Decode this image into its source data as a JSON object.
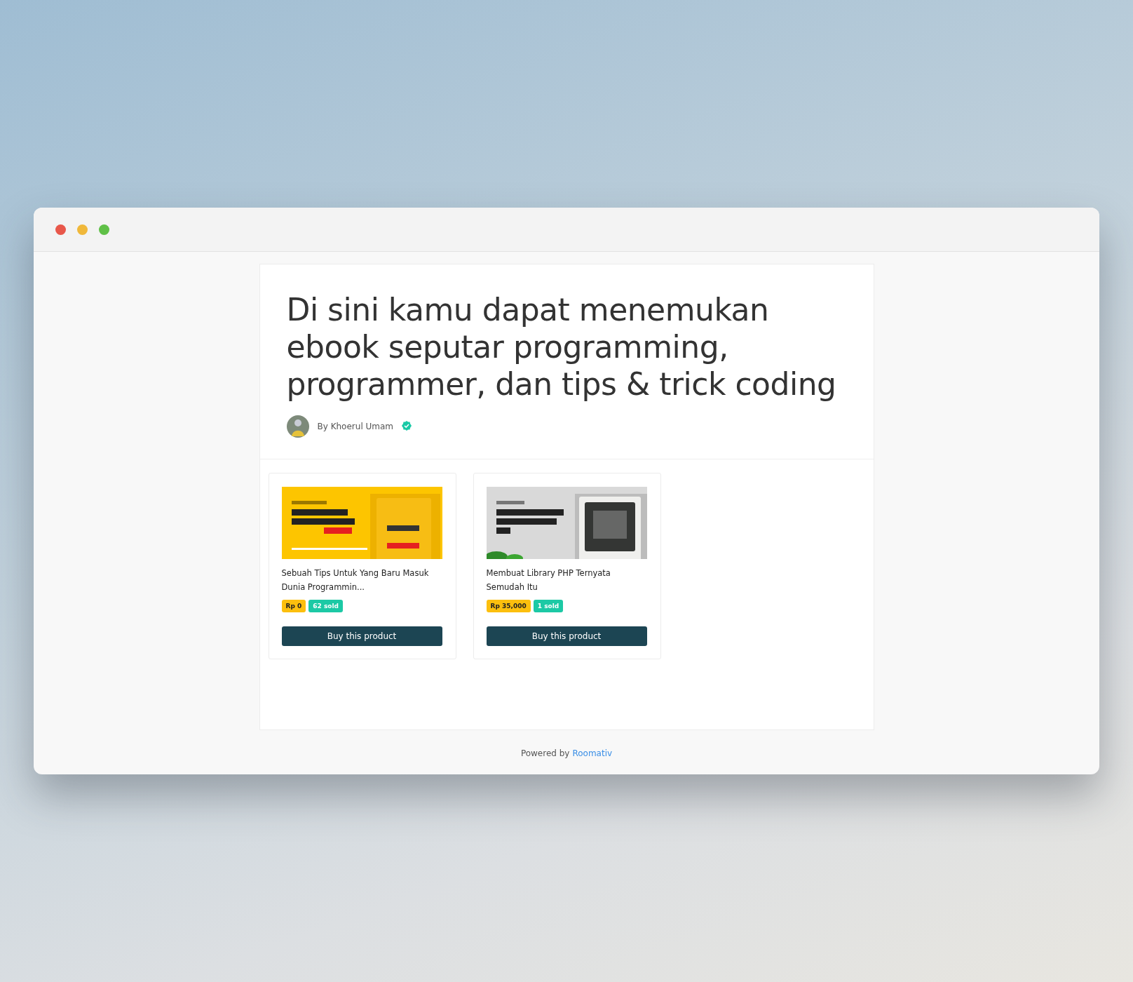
{
  "page": {
    "heading": "Di sini kamu dapat menemukan ebook seputar programming, programmer, dan tips & trick coding",
    "author": "By Khoerul Umam",
    "verified": true
  },
  "products": [
    {
      "title": "Sebuah Tips Untuk Yang Baru Masuk Dunia Programmin...",
      "price": "Rp 0",
      "sold": "62 sold",
      "button": "Buy this product"
    },
    {
      "title": "Membuat Library PHP Ternyata Semudah Itu",
      "price": "Rp 35,000",
      "sold": "1 sold",
      "button": "Buy this product"
    }
  ],
  "footer": {
    "text": "Powered by",
    "link": "Roomativ"
  }
}
